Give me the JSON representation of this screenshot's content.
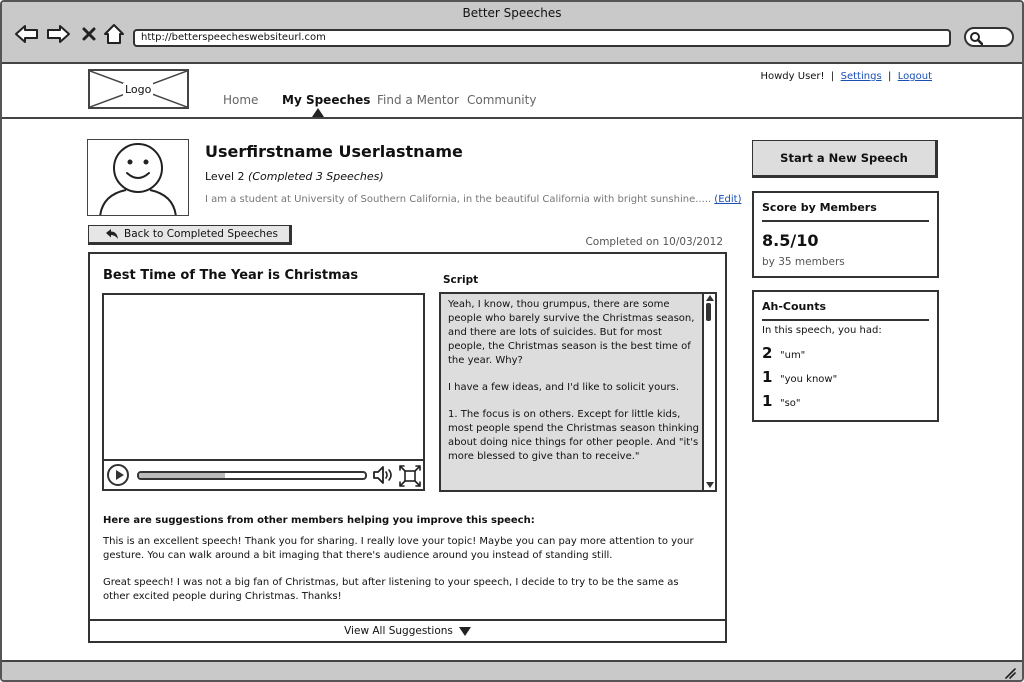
{
  "browser": {
    "window_title": "Better Speeches",
    "url": "http://betterspeecheswebsiteurl.com"
  },
  "site": {
    "logo_text": "Logo",
    "nav": [
      {
        "label": "Home",
        "active": false
      },
      {
        "label": "My Speeches",
        "active": true
      },
      {
        "label": "Find a Mentor",
        "active": false
      },
      {
        "label": "Community",
        "active": false
      }
    ],
    "user_links": {
      "greeting": "Howdy User!",
      "separator": "|",
      "settings": "Settings",
      "logout": "Logout"
    }
  },
  "profile": {
    "name": "Userfirstname Userlastname",
    "level": "Level 2",
    "completed_note": "(Completed 3 Speeches)",
    "bio": "I am a student at University of Southern California, in the beautiful California with bright sunshine.....",
    "edit_label": "(Edit)"
  },
  "speech": {
    "back_label": "Back to Completed Speeches",
    "completed_on": "Completed on 10/03/2012",
    "title": "Best Time of The Year is Christmas",
    "video_progress": 0.38,
    "script_label": "Script",
    "script_paragraphs": [
      "Yeah, I know, thou grumpus, there are some people who barely survive the Christmas season, and there are lots of suicides. But for most people, the Christmas season is the best time of the year. Why?",
      "I have a few ideas, and I'd like to solicit yours.",
      "1. The focus is on others. Except for little kids, most people spend the Christmas season thinking about doing nice things for other people. And \"it's more blessed to give than to receive.\""
    ],
    "suggestions_heading": "Here are suggestions from other members helping you improve this speech:",
    "suggestions": [
      "This is an excellent speech! Thank you for sharing. I really love your topic! Maybe you can pay more attention to your gesture. You can walk around a bit imaging that there's audience around you instead of standing still.",
      "Great speech! I was not a big fan of Christmas, but after listening to your speech, I decide to try to be the same as other excited people during Christmas. Thanks!"
    ],
    "view_all_label": "View All Suggestions"
  },
  "sidebar": {
    "start_button": "Start a New Speech",
    "score": {
      "title": "Score by Members",
      "value": "8.5/10",
      "sub": "by 35 members"
    },
    "ah_counts": {
      "title": "Ah-Counts",
      "intro": "In this speech, you had:",
      "items": [
        {
          "count": "2",
          "word": "\"um\""
        },
        {
          "count": "1",
          "word": "\"you know\""
        },
        {
          "count": "1",
          "word": "\"so\""
        }
      ]
    }
  }
}
